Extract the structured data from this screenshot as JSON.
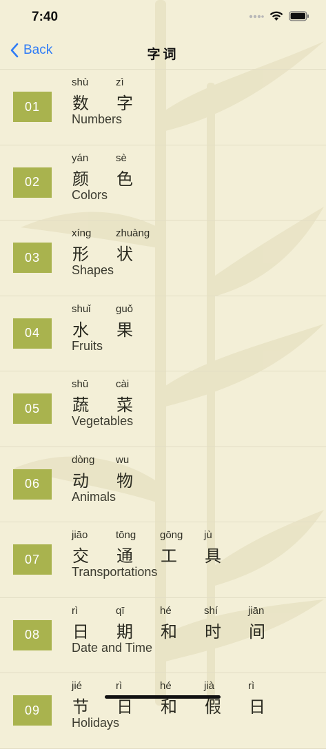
{
  "status": {
    "time": "7:40"
  },
  "nav": {
    "back_label": "Back",
    "title": "字词"
  },
  "icons": {
    "back": "chevron-left-icon",
    "wifi": "wifi-icon",
    "battery": "battery-icon",
    "cellular": "cellular-icon"
  },
  "colors": {
    "badge": "#a9b34e",
    "accent": "#2f7cf6",
    "background": "#f3efd7"
  },
  "items": [
    {
      "number": "01",
      "english": "Numbers",
      "chars": [
        {
          "py": "shù",
          "hz": "数"
        },
        {
          "py": "zì",
          "hz": "字"
        }
      ]
    },
    {
      "number": "02",
      "english": "Colors",
      "chars": [
        {
          "py": "yán",
          "hz": "颜"
        },
        {
          "py": "sè",
          "hz": "色"
        }
      ]
    },
    {
      "number": "03",
      "english": "Shapes",
      "chars": [
        {
          "py": "xíng",
          "hz": "形"
        },
        {
          "py": "zhuàng",
          "hz": "状"
        }
      ]
    },
    {
      "number": "04",
      "english": "Fruits",
      "chars": [
        {
          "py": "shuǐ",
          "hz": "水"
        },
        {
          "py": "guǒ",
          "hz": "果"
        }
      ]
    },
    {
      "number": "05",
      "english": "Vegetables",
      "chars": [
        {
          "py": "shū",
          "hz": "蔬"
        },
        {
          "py": "cài",
          "hz": "菜"
        }
      ]
    },
    {
      "number": "06",
      "english": "Animals",
      "chars": [
        {
          "py": "dòng",
          "hz": "动"
        },
        {
          "py": "wu",
          "hz": "物"
        }
      ]
    },
    {
      "number": "07",
      "english": "Transportations",
      "chars": [
        {
          "py": "jiāo",
          "hz": "交"
        },
        {
          "py": "tōng",
          "hz": "通"
        },
        {
          "py": "gōng",
          "hz": "工"
        },
        {
          "py": "jù",
          "hz": "具"
        }
      ]
    },
    {
      "number": "08",
      "english": "Date and Time",
      "chars": [
        {
          "py": "rì",
          "hz": "日"
        },
        {
          "py": "qī",
          "hz": "期"
        },
        {
          "py": "hé",
          "hz": "和"
        },
        {
          "py": "shí",
          "hz": "时"
        },
        {
          "py": "jiān",
          "hz": "间"
        }
      ]
    },
    {
      "number": "09",
      "english": "Holidays",
      "chars": [
        {
          "py": "jié",
          "hz": "节"
        },
        {
          "py": "rì",
          "hz": "日"
        },
        {
          "py": "hé",
          "hz": "和"
        },
        {
          "py": "jià",
          "hz": "假"
        },
        {
          "py": "rì",
          "hz": "日"
        }
      ]
    }
  ]
}
